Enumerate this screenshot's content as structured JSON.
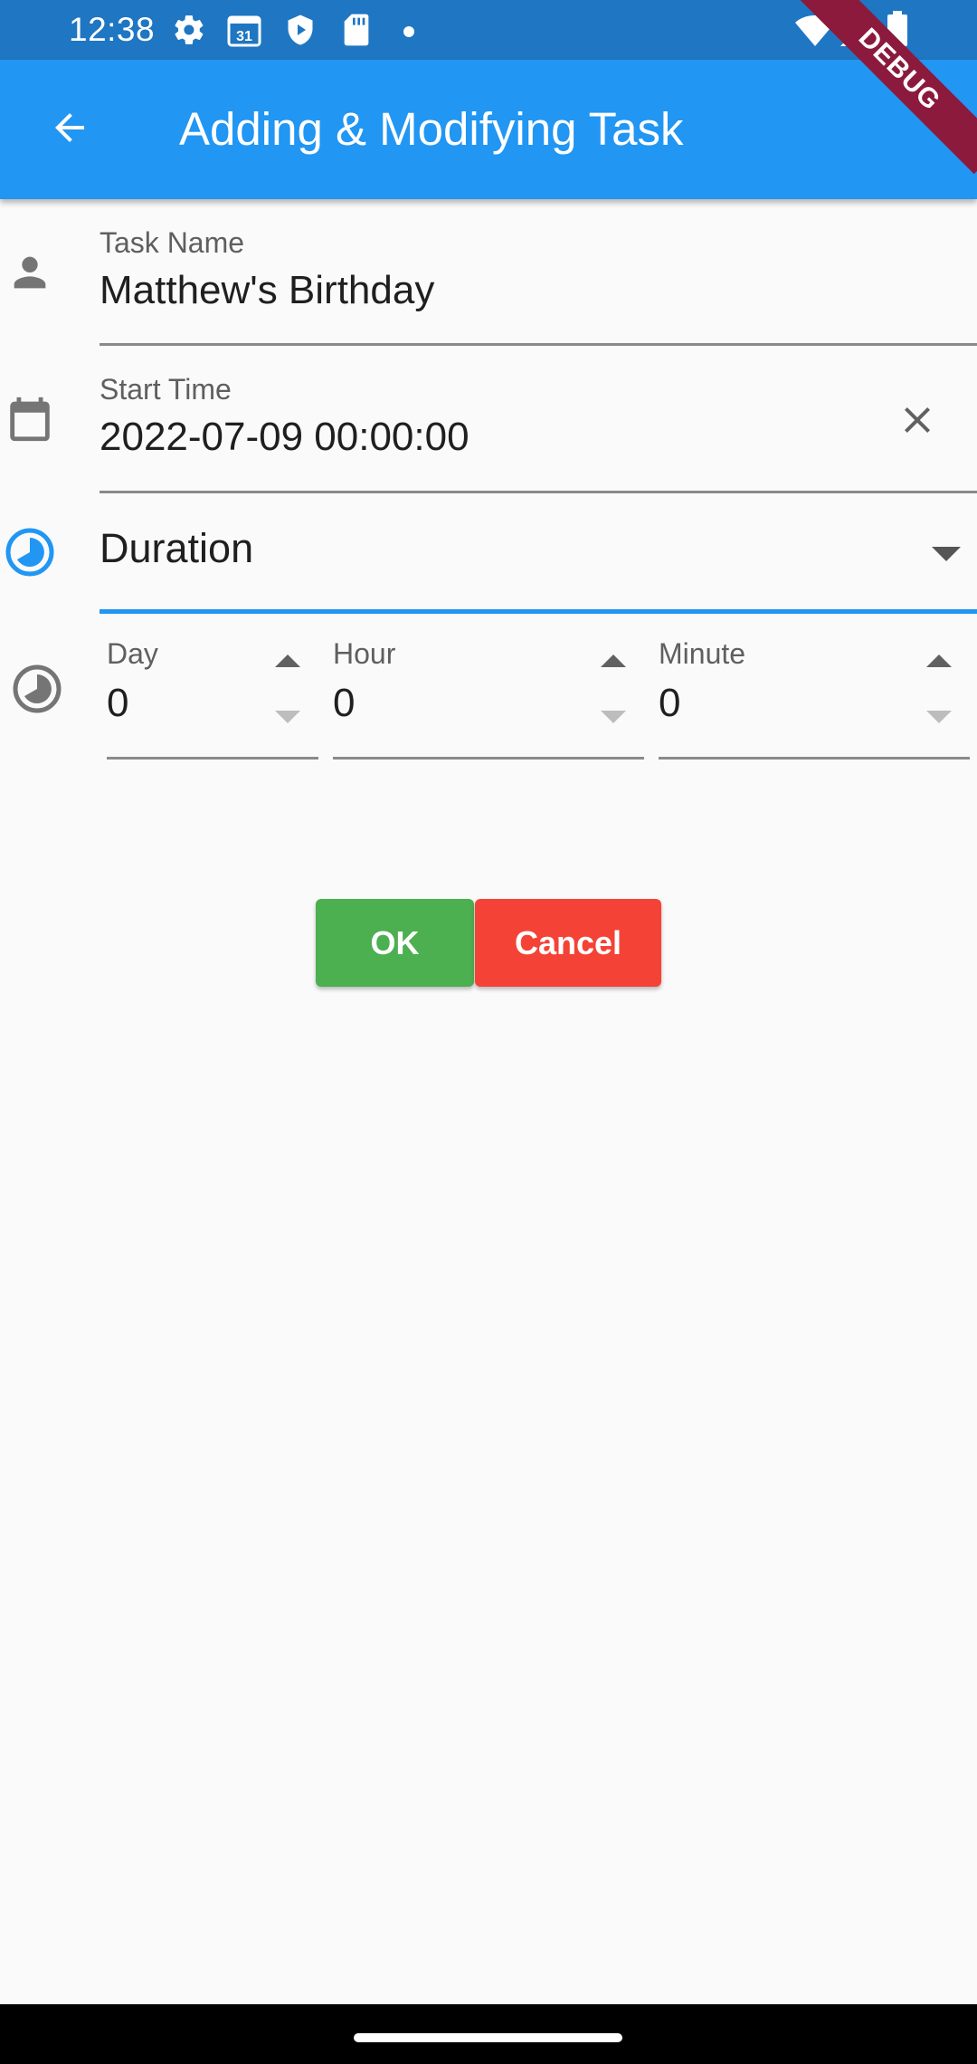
{
  "status_bar": {
    "time": "12:38",
    "calendar_date": "31",
    "icons_left": [
      "gear-icon",
      "calendar-icon",
      "shield-icon",
      "sd-card-icon",
      "dot-icon"
    ],
    "icons_right": [
      "wifi-icon",
      "signal-icon",
      "battery-icon"
    ],
    "bar_color": "#1f76c2"
  },
  "app_bar": {
    "title": "Adding & Modifying Task",
    "back_icon": "arrow-back-icon",
    "color": "#2196f3",
    "debug_banner": "DEBUG"
  },
  "form": {
    "task_name": {
      "label": "Task Name",
      "value": "Matthew's Birthday",
      "icon": "person-icon"
    },
    "start_time": {
      "label": "Start Time",
      "value": "2022-07-09 00:00:00",
      "icon": "calendar-icon",
      "clear_icon": "close-icon"
    },
    "duration_select": {
      "label": "Duration",
      "icon": "pie-clock-icon",
      "dropdown_icon": "caret-down-icon",
      "accent": "#2196f3"
    },
    "duration_fields": {
      "icon": "pie-clock-icon",
      "day": {
        "label": "Day",
        "value": "0"
      },
      "hour": {
        "label": "Hour",
        "value": "0"
      },
      "minute": {
        "label": "Minute",
        "value": "0"
      }
    }
  },
  "buttons": {
    "ok": {
      "label": "OK",
      "color": "#4caf50"
    },
    "cancel": {
      "label": "Cancel",
      "color": "#f44336"
    }
  }
}
